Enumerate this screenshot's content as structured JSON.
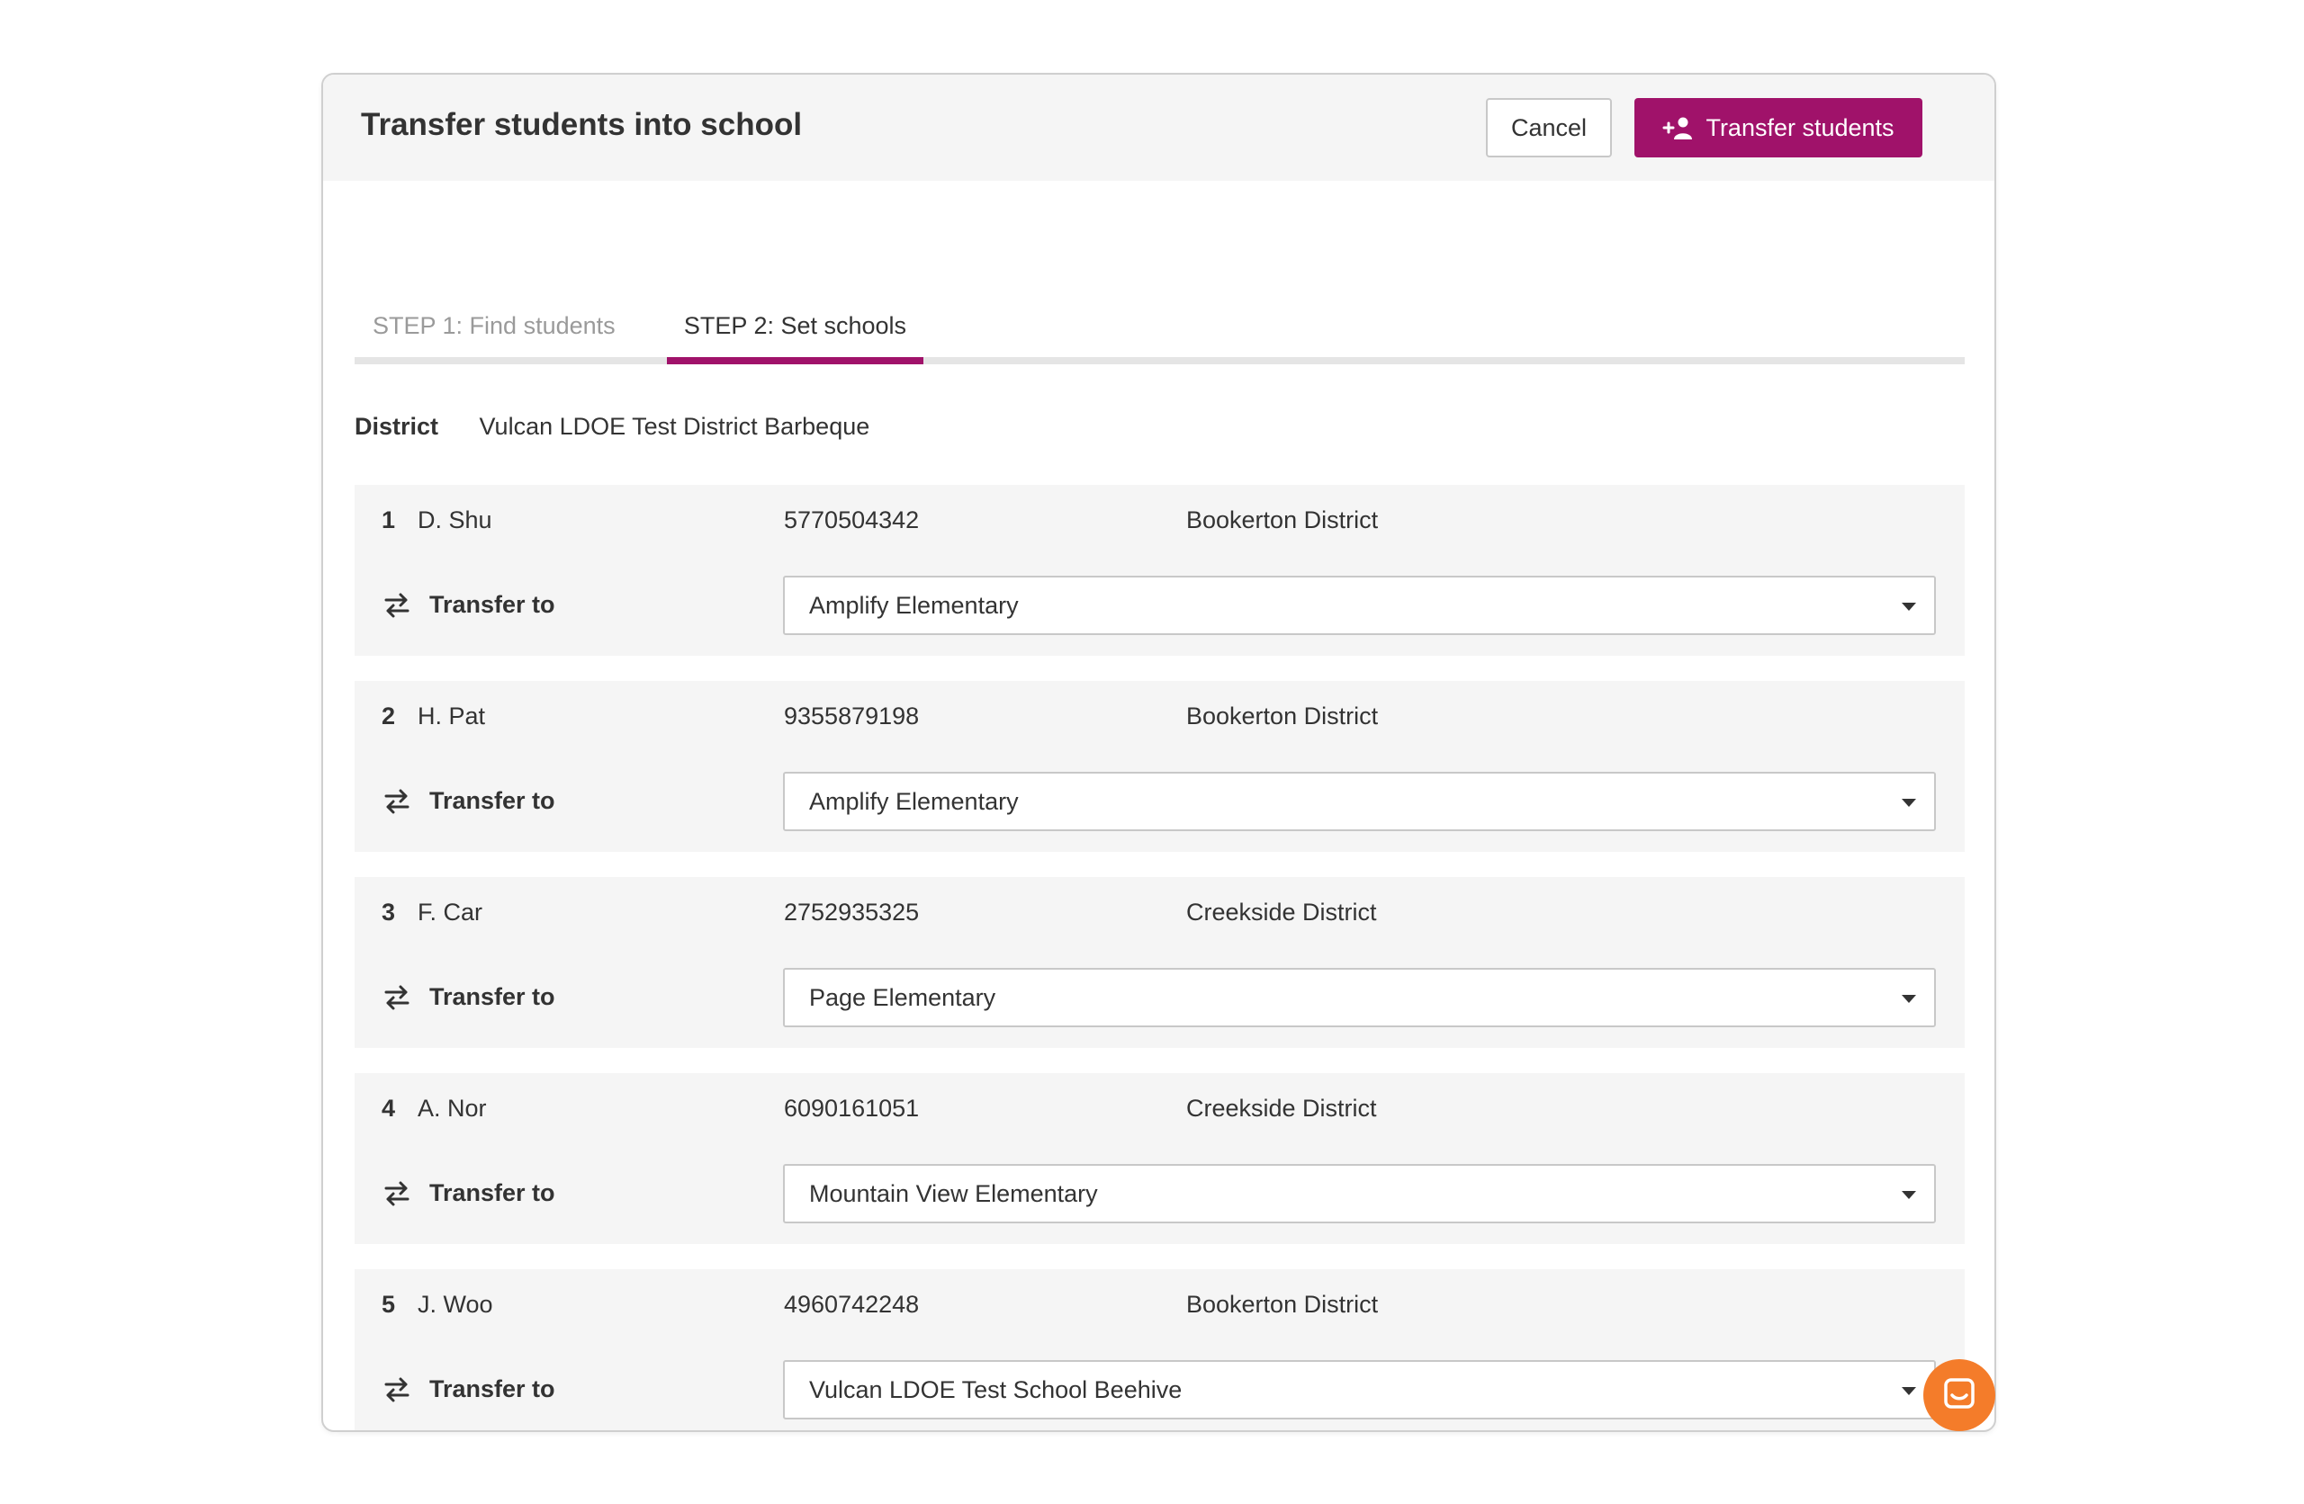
{
  "header": {
    "title": "Transfer students into school",
    "cancel_label": "Cancel",
    "transfer_label": "Transfer students"
  },
  "tabs": [
    {
      "label": "STEP 1: Find students",
      "active": false
    },
    {
      "label": "STEP 2: Set schools",
      "active": true
    }
  ],
  "district": {
    "label": "District",
    "value": "Vulcan LDOE Test District Barbeque"
  },
  "transfer_label": "Transfer to",
  "students": [
    {
      "num": "1",
      "name": "D. Shu",
      "id": "5770504342",
      "district": "Bookerton District",
      "school": "Amplify Elementary"
    },
    {
      "num": "2",
      "name": "H. Pat",
      "id": "9355879198",
      "district": "Bookerton District",
      "school": "Amplify Elementary"
    },
    {
      "num": "3",
      "name": "F. Car",
      "id": "2752935325",
      "district": "Creekside District",
      "school": "Page Elementary"
    },
    {
      "num": "4",
      "name": "A. Nor",
      "id": "6090161051",
      "district": "Creekside District",
      "school": "Mountain View Elementary"
    },
    {
      "num": "5",
      "name": "J. Woo",
      "id": "4960742248",
      "district": "Bookerton District",
      "school": "Vulcan LDOE Test School Beehive"
    }
  ],
  "colors": {
    "accent": "#a0126a",
    "chat": "#f47c2a",
    "row_bg": "#f5f5f5"
  },
  "icons": {
    "transfer_button": "add-user-icon",
    "row_transfer": "swap-arrows-icon",
    "select": "caret-down-icon",
    "chat": "chat-icon"
  }
}
